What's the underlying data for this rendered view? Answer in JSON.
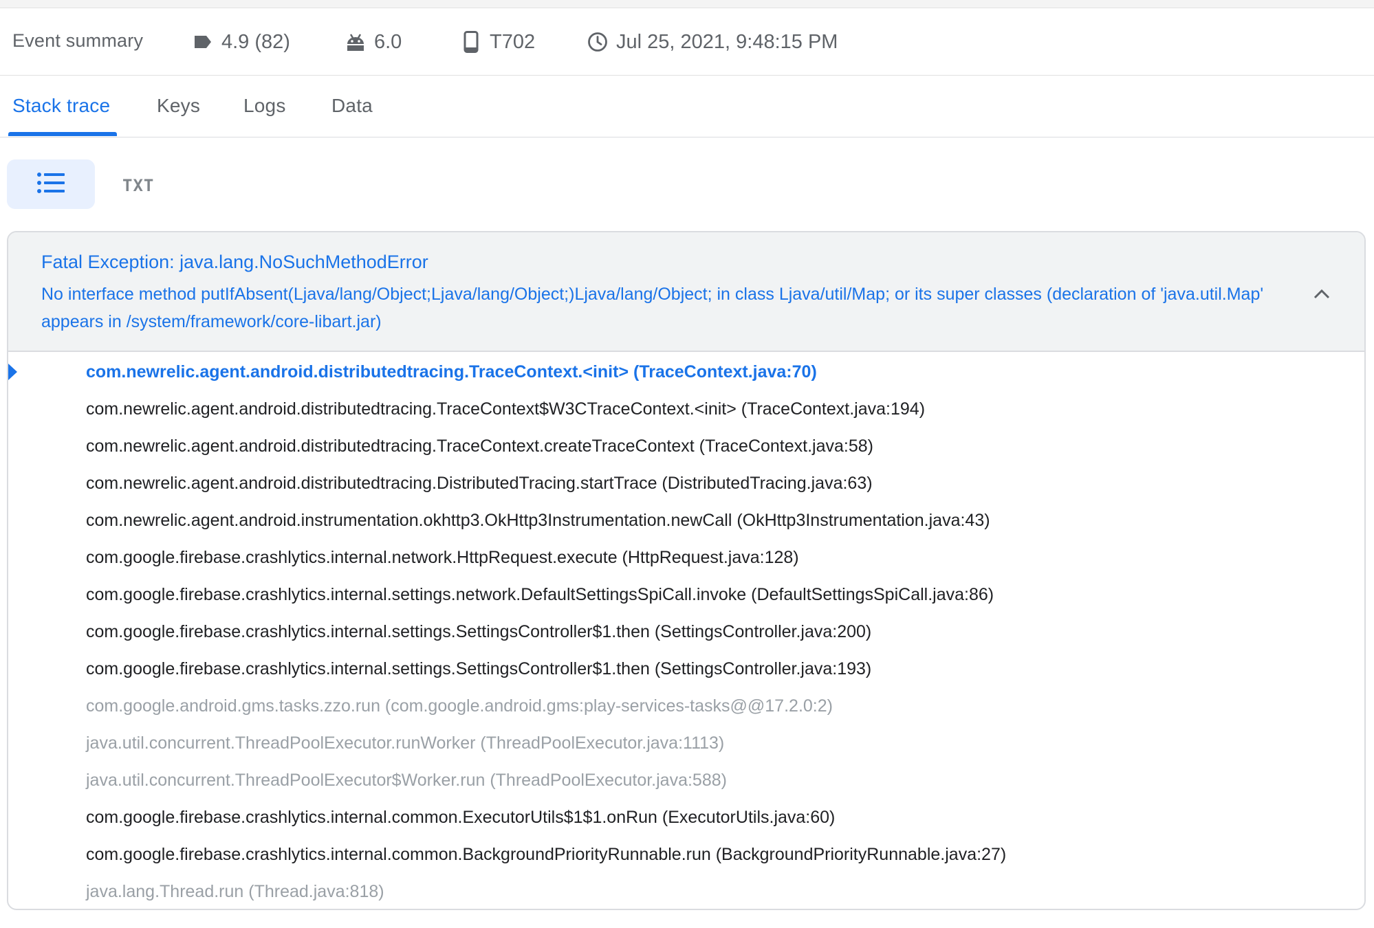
{
  "summary": {
    "title": "Event summary",
    "version": "4.9 (82)",
    "os": "6.0",
    "device": "T702",
    "timestamp": "Jul 25, 2021, 9:48:15 PM"
  },
  "tabs": [
    {
      "label": "Stack trace",
      "active": true
    },
    {
      "label": "Keys",
      "active": false
    },
    {
      "label": "Logs",
      "active": false
    },
    {
      "label": "Data",
      "active": false
    }
  ],
  "view_toggle": {
    "list_icon": "list-icon",
    "txt_label": "TXT"
  },
  "exception": {
    "title": "Fatal Exception: java.lang.NoSuchMethodError",
    "message": "No interface method putIfAbsent(Ljava/lang/Object;Ljava/lang/Object;)Ljava/lang/Object; in class Ljava/util/Map; or its super classes (declaration of 'java.util.Map' appears in /system/framework/core-libart.jar)",
    "collapse_icon": "chevron-up-icon"
  },
  "frames": [
    {
      "text": "com.newrelic.agent.android.distributedtracing.TraceContext.<init> (TraceContext.java:70)",
      "style": "highlight"
    },
    {
      "text": "com.newrelic.agent.android.distributedtracing.TraceContext$W3CTraceContext.<init> (TraceContext.java:194)",
      "style": "normal"
    },
    {
      "text": "com.newrelic.agent.android.distributedtracing.TraceContext.createTraceContext (TraceContext.java:58)",
      "style": "normal"
    },
    {
      "text": "com.newrelic.agent.android.distributedtracing.DistributedTracing.startTrace (DistributedTracing.java:63)",
      "style": "normal"
    },
    {
      "text": "com.newrelic.agent.android.instrumentation.okhttp3.OkHttp3Instrumentation.newCall (OkHttp3Instrumentation.java:43)",
      "style": "normal"
    },
    {
      "text": "com.google.firebase.crashlytics.internal.network.HttpRequest.execute (HttpRequest.java:128)",
      "style": "normal"
    },
    {
      "text": "com.google.firebase.crashlytics.internal.settings.network.DefaultSettingsSpiCall.invoke (DefaultSettingsSpiCall.java:86)",
      "style": "normal"
    },
    {
      "text": "com.google.firebase.crashlytics.internal.settings.SettingsController$1.then (SettingsController.java:200)",
      "style": "normal"
    },
    {
      "text": "com.google.firebase.crashlytics.internal.settings.SettingsController$1.then (SettingsController.java:193)",
      "style": "normal"
    },
    {
      "text": "com.google.android.gms.tasks.zzo.run (com.google.android.gms:play-services-tasks@@17.2.0:2)",
      "style": "dim"
    },
    {
      "text": "java.util.concurrent.ThreadPoolExecutor.runWorker (ThreadPoolExecutor.java:1113)",
      "style": "dim"
    },
    {
      "text": "java.util.concurrent.ThreadPoolExecutor$Worker.run (ThreadPoolExecutor.java:588)",
      "style": "dim"
    },
    {
      "text": "com.google.firebase.crashlytics.internal.common.ExecutorUtils$1$1.onRun (ExecutorUtils.java:60)",
      "style": "normal"
    },
    {
      "text": "com.google.firebase.crashlytics.internal.common.BackgroundPriorityRunnable.run (BackgroundPriorityRunnable.java:27)",
      "style": "normal"
    },
    {
      "text": "java.lang.Thread.run (Thread.java:818)",
      "style": "dim"
    }
  ],
  "colors": {
    "accent": "#1a73e8",
    "text_primary": "#202124",
    "text_secondary": "#5f6368",
    "text_dim": "#9aa0a6",
    "header_bg": "#f1f3f4",
    "toggle_bg": "#e8f0fe"
  }
}
